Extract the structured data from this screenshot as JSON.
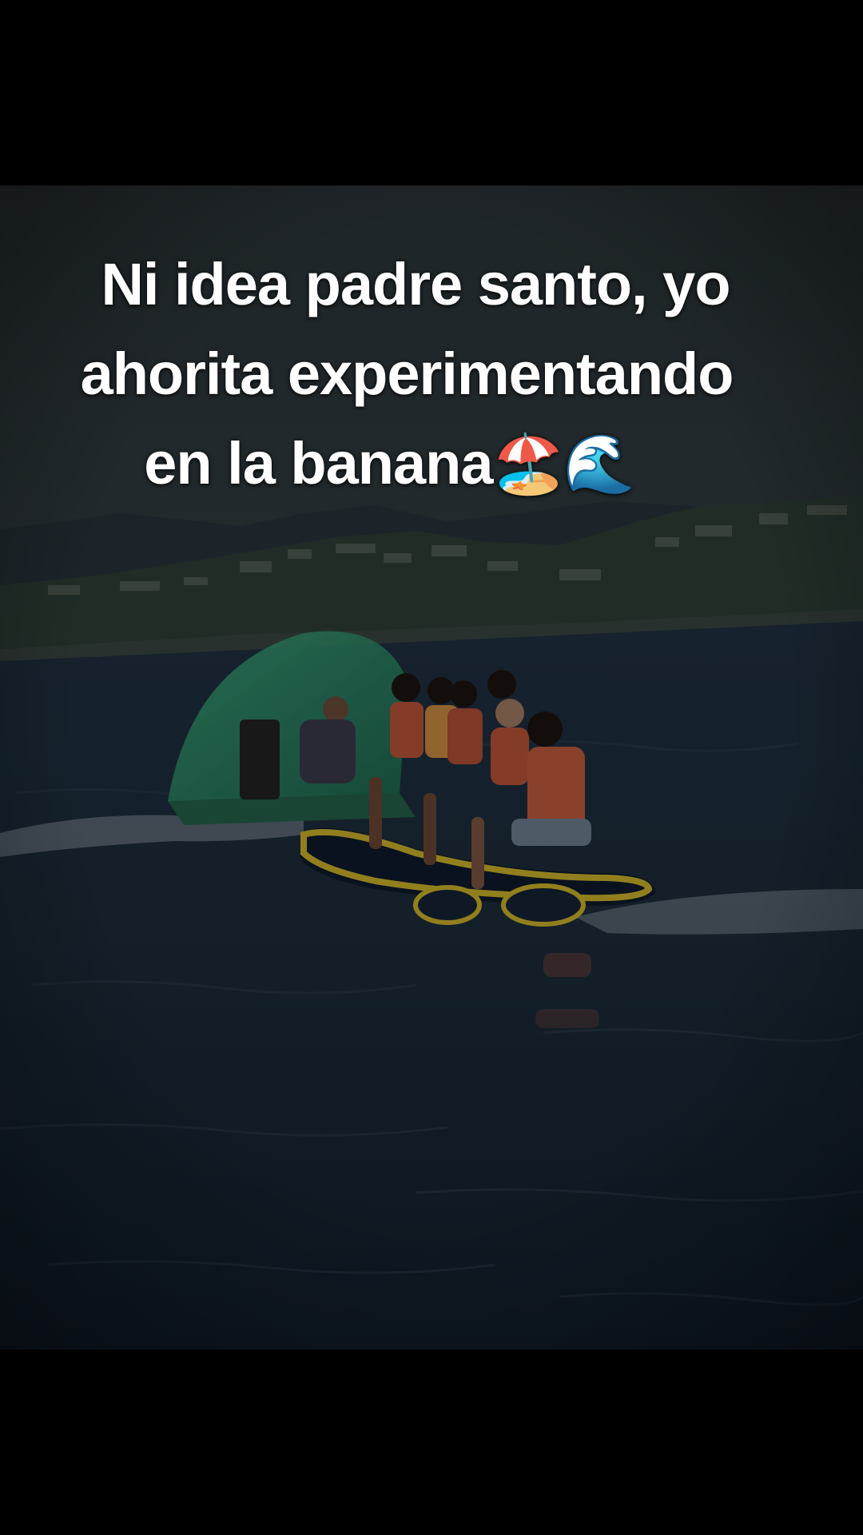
{
  "caption": {
    "line_1": "Ni idea padre santo, yo",
    "line_2": "ahorita experimentando",
    "line_3_text": "en la banana",
    "line_3_emojis": "🏖️🌊"
  },
  "scene": {
    "subject": "banana-boat-ride",
    "colors": {
      "sky": "#2a3338",
      "hills": "#2c3a35",
      "town": "#556055",
      "sea": "#1c2a38",
      "sea_dark": "#13202d",
      "boat_canopy": "#2f8f6a",
      "banana_yellow": "#c9b02a",
      "life_vest": "#b8543a",
      "foam": "#8a96a0"
    }
  }
}
